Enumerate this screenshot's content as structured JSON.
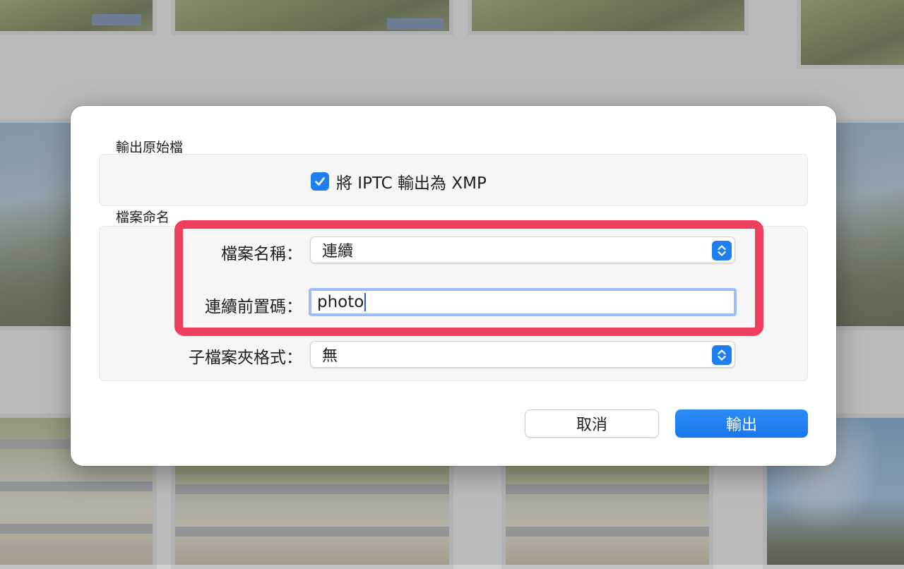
{
  "dialog": {
    "section_export_original": "輸出原始檔",
    "checkbox_iptc": {
      "label": "將 IPTC 輸出為 XMP",
      "checked": true
    },
    "section_file_naming": "檔案命名",
    "fields": {
      "file_name": {
        "label": "檔案名稱：",
        "value": "連續"
      },
      "sequential_prefix": {
        "label": "連續前置碼：",
        "value": "photo"
      },
      "subfolder_format": {
        "label": "子檔案夾格式：",
        "value": "無"
      }
    },
    "buttons": {
      "cancel": "取消",
      "export": "輸出"
    }
  },
  "colors": {
    "accent": "#1f7ef0",
    "highlight": "#ef3f5d"
  }
}
